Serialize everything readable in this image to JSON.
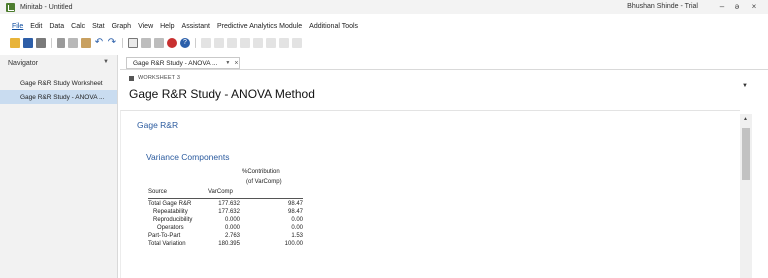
{
  "window": {
    "title": "Minitab - Untitled",
    "user": "Bhushan Shinde - Trial",
    "minimize_glyph": "–",
    "maximize_glyph": "ə",
    "close_glyph": "×"
  },
  "menu": [
    "File",
    "Edit",
    "Data",
    "Calc",
    "Stat",
    "Graph",
    "View",
    "Help",
    "Assistant",
    "Predictive Analytics Module",
    "Additional Tools"
  ],
  "toolbar": {
    "undo_glyph": "↶",
    "redo_glyph": "↷",
    "help_glyph": "?"
  },
  "navigator": {
    "title": "Navigator",
    "items": [
      {
        "label": "Gage R&R Study Worksheet"
      },
      {
        "label": "Gage R&R Study - ANOVA ..."
      }
    ]
  },
  "tab": {
    "label": "Gage R&R Study - ANOVA ...",
    "chevron": "▼",
    "close": "×"
  },
  "worksheet": {
    "label": "WORKSHEET 3",
    "title": "Gage R&R Study - ANOVA Method"
  },
  "output": {
    "section_title": "Gage R&R",
    "subsection_title": "Variance Components",
    "columns": {
      "source": "Source",
      "varcomp": "VarComp",
      "contrib_line1": "%Contribution",
      "contrib_line2": "(of VarComp)"
    },
    "rows": [
      {
        "source": "Total Gage R&R",
        "varcomp": "177.632",
        "contrib": "98.47",
        "indent": 0
      },
      {
        "source": "Repeatability",
        "varcomp": "177.632",
        "contrib": "98.47",
        "indent": 1
      },
      {
        "source": "Reproducibility",
        "varcomp": "0.000",
        "contrib": "0.00",
        "indent": 1
      },
      {
        "source": "Operators",
        "varcomp": "0.000",
        "contrib": "0.00",
        "indent": 2
      },
      {
        "source": "Part-To-Part",
        "varcomp": "2.763",
        "contrib": "1.53",
        "indent": 0
      },
      {
        "source": "Total Variation",
        "varcomp": "180.395",
        "contrib": "100.00",
        "indent": 0
      }
    ]
  },
  "colors": {
    "accent": "#2a5a9e",
    "nav_selected": "#c9dcf0"
  }
}
